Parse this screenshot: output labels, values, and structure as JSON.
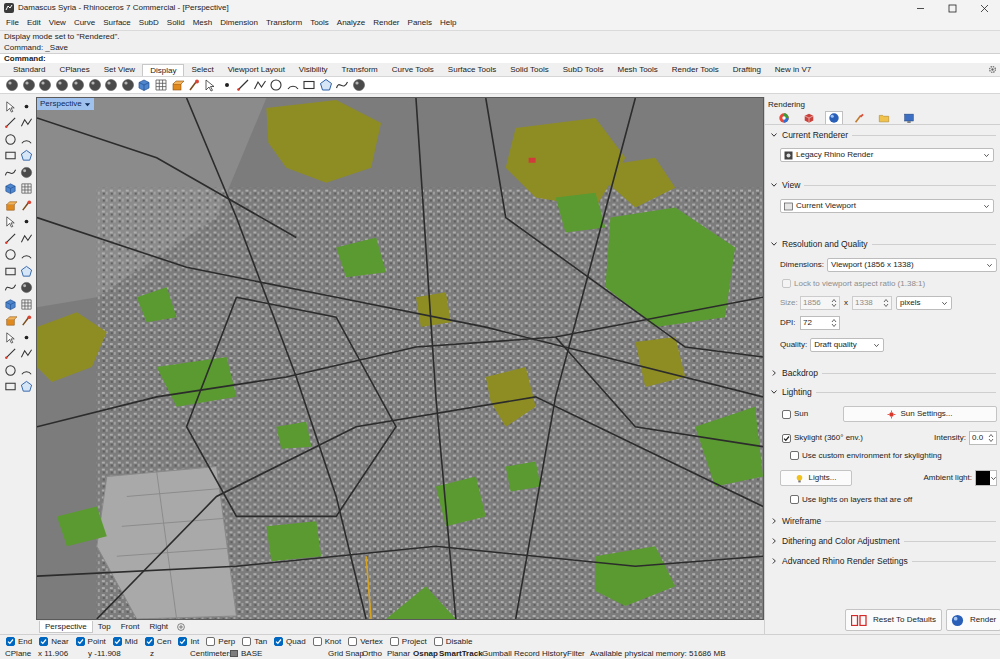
{
  "window": {
    "title": "Damascus Syria - Rhinoceros 7 Commercial - [Perspective]"
  },
  "menu": [
    "File",
    "Edit",
    "View",
    "Curve",
    "Surface",
    "SubD",
    "Solid",
    "Mesh",
    "Dimension",
    "Transform",
    "Tools",
    "Analyze",
    "Render",
    "Panels",
    "Help"
  ],
  "command": {
    "history": [
      "Display mode set to \"Rendered\".",
      "Command: _Save"
    ],
    "prompt": "Command:"
  },
  "toolbar_tabs": [
    {
      "label": "Standard",
      "selected": false
    },
    {
      "label": "CPlanes",
      "selected": false
    },
    {
      "label": "Set View",
      "selected": false
    },
    {
      "label": "Display",
      "selected": true
    },
    {
      "label": "Select",
      "selected": false
    },
    {
      "label": "Viewport Layout",
      "selected": false
    },
    {
      "label": "Visibility",
      "selected": false
    },
    {
      "label": "Transform",
      "selected": false
    },
    {
      "label": "Curve Tools",
      "selected": false
    },
    {
      "label": "Surface Tools",
      "selected": false
    },
    {
      "label": "Solid Tools",
      "selected": false
    },
    {
      "label": "SubD Tools",
      "selected": false
    },
    {
      "label": "Mesh Tools",
      "selected": false
    },
    {
      "label": "Render Tools",
      "selected": false
    },
    {
      "label": "Drafting",
      "selected": false
    },
    {
      "label": "New in V7",
      "selected": false
    }
  ],
  "viewport": {
    "label": "Perspective",
    "active": true
  },
  "viewport_tabs": [
    {
      "label": "Perspective",
      "selected": true
    },
    {
      "label": "Top",
      "selected": false
    },
    {
      "label": "Front",
      "selected": false
    },
    {
      "label": "Right",
      "selected": false
    }
  ],
  "osnaps": [
    {
      "label": "End",
      "checked": true
    },
    {
      "label": "Near",
      "checked": true
    },
    {
      "label": "Point",
      "checked": true
    },
    {
      "label": "Mid",
      "checked": true
    },
    {
      "label": "Cen",
      "checked": true
    },
    {
      "label": "Int",
      "checked": true
    },
    {
      "label": "Perp",
      "checked": false
    },
    {
      "label": "Tan",
      "checked": false
    },
    {
      "label": "Quad",
      "checked": true
    },
    {
      "label": "Knot",
      "checked": false
    },
    {
      "label": "Vertex",
      "checked": false
    },
    {
      "label": "Project",
      "checked": false
    },
    {
      "label": "Disable",
      "checked": false
    }
  ],
  "status_bar": [
    {
      "label": "CPlane",
      "bold": false,
      "kind": "text"
    },
    {
      "label": "x 11.906",
      "bold": false,
      "kind": "text"
    },
    {
      "label": "y -11.908",
      "bold": false,
      "kind": "text"
    },
    {
      "label": "z",
      "bold": false,
      "kind": "text"
    },
    {
      "label": "Centimeters",
      "bold": false,
      "kind": "text"
    },
    {
      "label": "BASE",
      "bold": false,
      "kind": "layer"
    },
    {
      "label": "Grid Snap",
      "bold": false,
      "kind": "toggle"
    },
    {
      "label": "Ortho",
      "bold": false,
      "kind": "toggle"
    },
    {
      "label": "Planar",
      "bold": false,
      "kind": "toggle"
    },
    {
      "label": "Osnap",
      "bold": true,
      "kind": "toggle"
    },
    {
      "label": "SmartTrack",
      "bold": true,
      "kind": "toggle"
    },
    {
      "label": "Gumball",
      "bold": false,
      "kind": "toggle"
    },
    {
      "label": "Record History",
      "bold": false,
      "kind": "toggle"
    },
    {
      "label": "Filter",
      "bold": false,
      "kind": "toggle"
    },
    {
      "label": "Available physical memory: 51686 MB",
      "bold": false,
      "kind": "text"
    }
  ],
  "rendering": {
    "title": "Rendering",
    "tabs": [
      {
        "kind": "color",
        "selected": false
      },
      {
        "kind": "material",
        "selected": false
      },
      {
        "kind": "render",
        "selected": true
      },
      {
        "kind": "texture",
        "selected": false
      },
      {
        "kind": "file",
        "selected": false
      },
      {
        "kind": "display",
        "selected": false
      }
    ],
    "current_renderer": {
      "title": "Current Renderer",
      "expanded": true,
      "value": "Legacy Rhino Render"
    },
    "view": {
      "title": "View",
      "expanded": true,
      "value": "Current Viewport"
    },
    "resolution": {
      "title": "Resolution and Quality",
      "expanded": true,
      "dimensions": {
        "label": "Dimensions:",
        "value": "Viewport (1856 x 1338)"
      },
      "lock": {
        "label": "Lock to viewport aspect ratio (1.38:1)",
        "checked": false,
        "disabled": true
      },
      "size": {
        "label": "Size:",
        "width": "1856",
        "separator": "x",
        "height": "1338",
        "unit": "pixels",
        "disabled": true
      },
      "dpi": {
        "label": "DPI:",
        "value": "72"
      },
      "quality": {
        "label": "Quality:",
        "value": "Draft quality"
      }
    },
    "backdrop": {
      "title": "Backdrop",
      "expanded": false
    },
    "lighting": {
      "title": "Lighting",
      "expanded": true,
      "sun": {
        "label": "Sun",
        "checked": false
      },
      "sun_settings": "Sun Settings...",
      "skylight": {
        "label": "Skylight (360° env.)",
        "checked": true
      },
      "intensity": {
        "label": "Intensity:",
        "value": "0.0"
      },
      "custom_env": {
        "label": "Use custom environment for skylighting",
        "checked": false
      },
      "lights_button": "Lights...",
      "ambient": {
        "label": "Ambient light:",
        "color": "#000000"
      },
      "lights_off": {
        "label": "Use lights on layers that are off",
        "checked": false
      }
    },
    "more_sections": [
      {
        "title": "Wireframe",
        "expanded": false
      },
      {
        "title": "Dithering and Color Adjustment",
        "expanded": false
      },
      {
        "title": "Advanced Rhino Render Settings",
        "expanded": false
      }
    ],
    "buttons": [
      "Reset To Defaults",
      "Render"
    ]
  }
}
